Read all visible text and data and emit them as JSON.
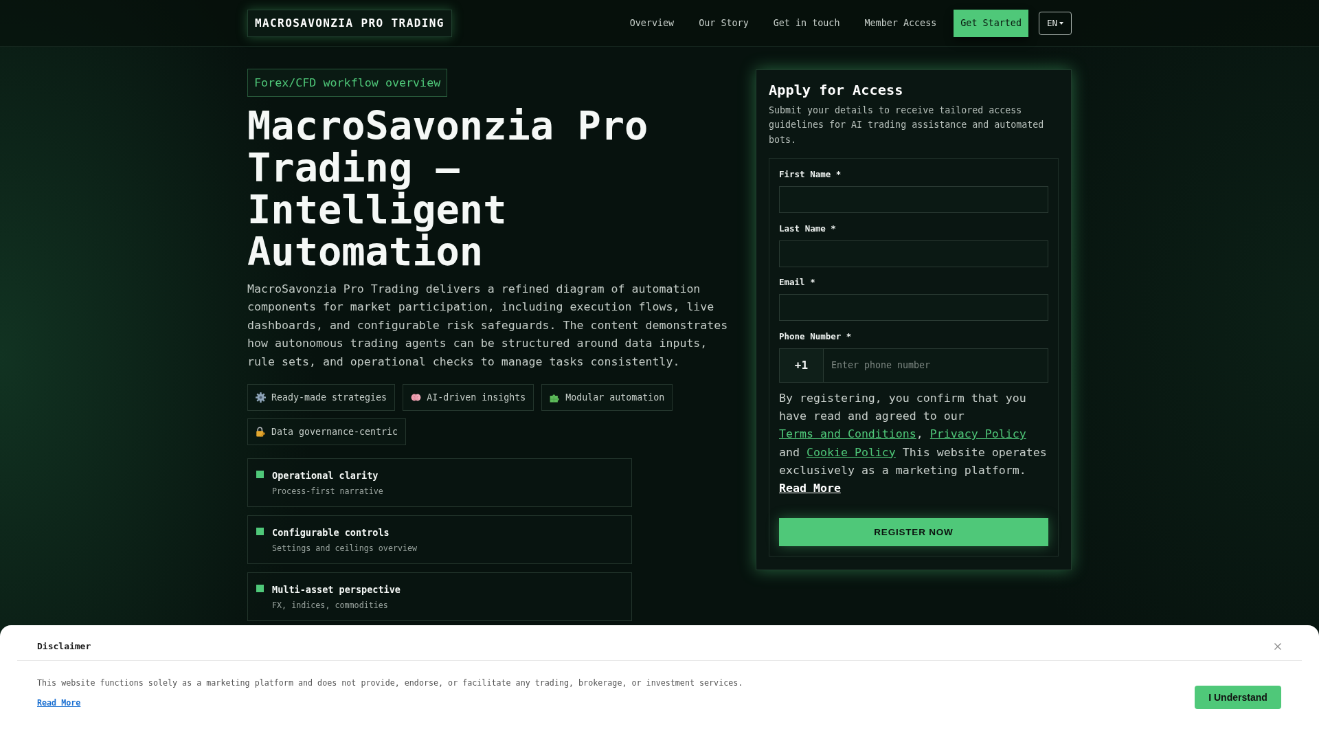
{
  "header": {
    "logo": "MACROSAVONZIA PRO TRADING",
    "nav": [
      {
        "label": "Overview"
      },
      {
        "label": "Our Story"
      },
      {
        "label": "Get in touch"
      },
      {
        "label": "Member Access"
      }
    ],
    "cta": "Get Started",
    "language": "EN"
  },
  "hero": {
    "badge": "Forex/CFD workflow overview",
    "title": "MacroSavonzia Pro Trading — Intelligent Automation",
    "description": "MacroSavonzia Pro Trading delivers a refined diagram of automation components for market participation, including execution flows, live dashboards, and configurable risk safeguards. The content demonstrates how autonomous trading agents can be structured around data inputs, rule sets, and operational checks to manage tasks consistently.",
    "chips": [
      "Ready-made strategies",
      "AI-driven insights",
      "Modular automation",
      "Data governance-centric"
    ],
    "features": [
      {
        "title": "Operational clarity",
        "subtitle": "Process-first narrative"
      },
      {
        "title": "Configurable controls",
        "subtitle": "Settings and ceilings overview"
      },
      {
        "title": "Multi-asset perspective",
        "subtitle": "FX, indices, commodities"
      }
    ]
  },
  "form": {
    "title": "Apply for Access",
    "subtitle": "Submit your details to receive tailored access guidelines for AI trading assistance and automated bots.",
    "fields": [
      {
        "kind": "text",
        "label": "First Name *"
      },
      {
        "kind": "text",
        "label": "Last Name *"
      },
      {
        "kind": "text",
        "label": "Email *"
      },
      {
        "kind": "phone",
        "label": "Phone Number *",
        "prefix": "+1",
        "placeholder": "Enter phone number"
      }
    ],
    "consent": [
      {
        "kind": "text",
        "text": "By registering, you confirm that you have read and agreed to our "
      },
      {
        "kind": "link",
        "text": "Terms and Conditions"
      },
      {
        "kind": "text",
        "text": ", "
      },
      {
        "kind": "link",
        "text": "Privacy Policy"
      },
      {
        "kind": "text",
        "text": " and "
      },
      {
        "kind": "link",
        "text": "Cookie Policy"
      },
      {
        "kind": "text",
        "text": " This website operates exclusively as a marketing platform. "
      },
      {
        "kind": "strong_link",
        "text": "Read More"
      }
    ],
    "submit": "REGISTER NOW"
  },
  "disclaimer": {
    "title": "Disclaimer",
    "text": "This website functions solely as a marketing platform and does not provide, endorse, or facilitate any trading, brokerage, or investment services.",
    "link": "Read More",
    "button": "I Understand"
  }
}
